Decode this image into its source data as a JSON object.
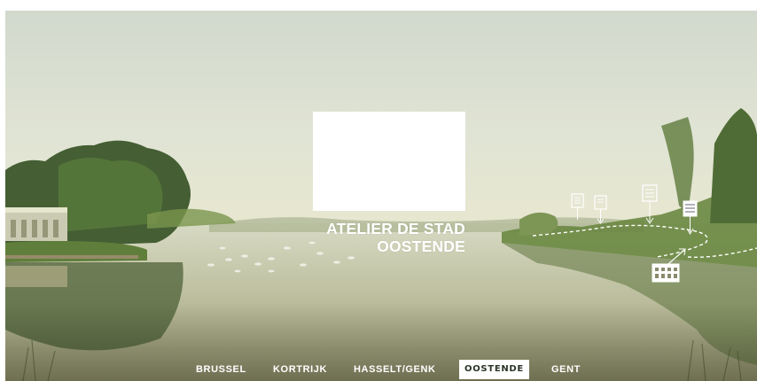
{
  "hero": {
    "title_line1": "ATELIER DE STAD",
    "title_line2": "OOSTENDE",
    "background": "river-landscape-photo",
    "route_icons": [
      "document-icon",
      "document-icon",
      "document-icon",
      "newspaper-icon",
      "building-icon"
    ]
  },
  "nav": {
    "items": [
      {
        "label": "BRUSSEL",
        "active": false
      },
      {
        "label": "KORTRIJK",
        "active": false
      },
      {
        "label": "HASSELT/GENK",
        "active": false
      },
      {
        "label": "OOSTENDE",
        "active": true
      },
      {
        "label": "GENT",
        "active": false
      }
    ]
  },
  "colors": {
    "sky": "#d9ded0",
    "water": "#b8bca0",
    "foliage": "#3f5a22",
    "active_nav_bg": "#ffffff",
    "active_nav_text": "#2c3526"
  }
}
